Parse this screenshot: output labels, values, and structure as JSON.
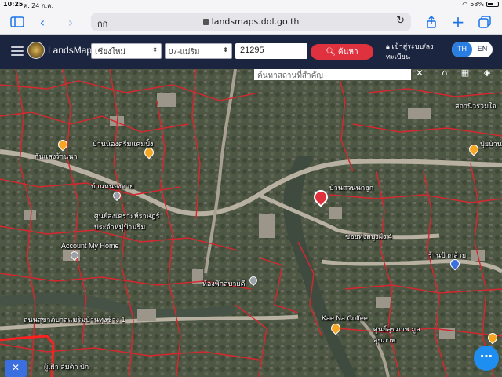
{
  "status_bar": {
    "time": "10:25",
    "date": "ศ. 24 ก.ค.",
    "battery_text": "58%",
    "battery_level": 0.58
  },
  "safari": {
    "aa_label": "กก",
    "url": "landsmaps.dol.go.th",
    "icons": [
      "sidebar-icon",
      "back-icon",
      "forward-icon",
      "reload-icon",
      "share-icon",
      "new-tab-icon",
      "tabs-icon"
    ]
  },
  "header": {
    "brand": "LandsMaps",
    "province": "เชียงใหม่",
    "district": "07-แม่ริม",
    "parcel_number": "21295",
    "search_label": "ค้นหา",
    "login_label": "เข้าสู่ระบบ/ลงทะเบียน",
    "lang_options": [
      "TH",
      "EN"
    ],
    "active_lang": "TH",
    "accent_color": "#e0313f",
    "header_color": "#1c2540"
  },
  "map": {
    "search_placeholder": "ค้นหาสถานที่สำคัญ",
    "places": [
      {
        "id": "baan-nong-dream",
        "label": "บ้านน้องดรีมแคมปิ้ง"
      },
      {
        "id": "baan-kaew",
        "label": "กันแสงร้านนา"
      },
      {
        "id": "account-my-home",
        "label": "Account My Home"
      },
      {
        "id": "community-center",
        "label": "ศูนย์ส่งเคราะห์ราษฎร์ ประจำหมู่บ้านริม"
      },
      {
        "id": "baan-nong-jaturong",
        "label": "บ้านหนองจาย"
      },
      {
        "id": "kae-na-coffee",
        "label": "Kae Na Coffee"
      },
      {
        "id": "baan-suan-nok",
        "label": "บ้านสวนนกฮูก"
      },
      {
        "id": "health-center",
        "label": "ศูนย์สุขภาพ มูลสุขภาพ"
      },
      {
        "id": "room-rental",
        "label": "ห้องพักสบายดี"
      },
      {
        "id": "road-sukhaphiban",
        "label": "ถนนสุขาภิบาลแม่ริมบ้านทุ่งช้าง 1"
      },
      {
        "id": "road-local",
        "label": "ซอยทุ่งสบูงฝั่ง 4"
      },
      {
        "id": "shop",
        "label": "ร้านป้ากล้วย"
      },
      {
        "id": "school",
        "label": "สถานีวรวมใจ"
      },
      {
        "id": "corner",
        "label": "ปุ๋ยบ้าน"
      },
      {
        "id": "bottom-left",
        "label": "ผู้เฝ้า ลัมต้า ปิก"
      }
    ],
    "tool_icons": [
      "close-icon",
      "home-icon",
      "grid-icon",
      "layers-icon"
    ]
  }
}
